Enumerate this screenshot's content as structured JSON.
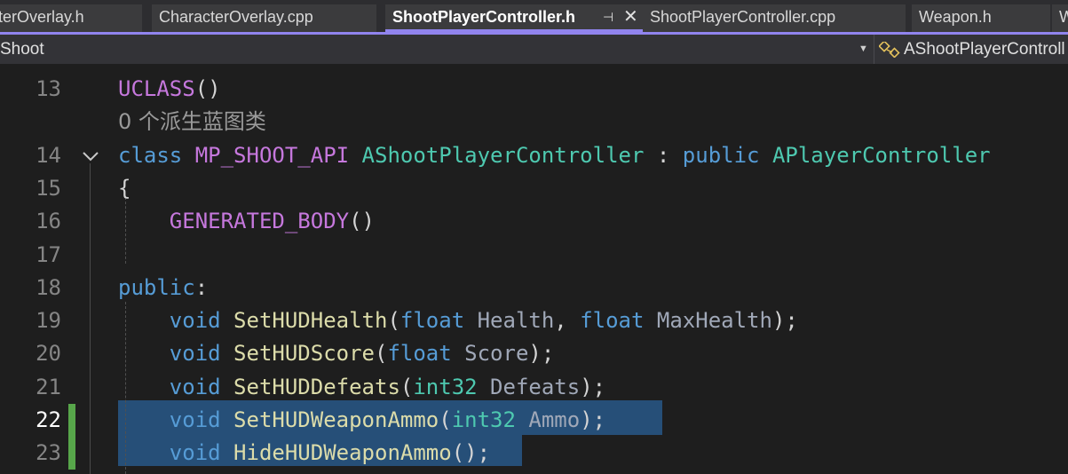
{
  "tabs": [
    {
      "label": "terOverlay.h",
      "active": false
    },
    {
      "label": "CharacterOverlay.cpp",
      "active": false
    },
    {
      "label": "ShootPlayerController.h",
      "active": true
    },
    {
      "label": "ShootPlayerController.cpp",
      "active": false
    },
    {
      "label": "Weapon.h",
      "active": false
    },
    {
      "label": "W",
      "active": false
    }
  ],
  "nav": {
    "project": "Shoot",
    "scope": "AShootPlayerControll"
  },
  "colors": {
    "accent": "#9184ee",
    "selection": "#264f78",
    "change_marker": "#57a64a"
  },
  "lines": [
    {
      "num": "13",
      "tokens": [
        {
          "t": "UCLASS",
          "c": "macro"
        },
        {
          "t": "()",
          "c": "p"
        }
      ]
    },
    {
      "num": "",
      "hint": "0 个派生蓝图类"
    },
    {
      "num": "14",
      "tokens": [
        {
          "t": "class ",
          "c": "kw"
        },
        {
          "t": "MP_SHOOT_API ",
          "c": "macro"
        },
        {
          "t": "AShootPlayerController",
          "c": "type"
        },
        {
          "t": " : ",
          "c": "p"
        },
        {
          "t": "public ",
          "c": "kw"
        },
        {
          "t": "APlayerController",
          "c": "type"
        }
      ]
    },
    {
      "num": "15",
      "tokens": [
        {
          "t": "{",
          "c": "p"
        }
      ]
    },
    {
      "num": "16",
      "tokens": [
        {
          "t": "    ",
          "c": "p"
        },
        {
          "t": "GENERATED_BODY",
          "c": "macro"
        },
        {
          "t": "()",
          "c": "p"
        }
      ]
    },
    {
      "num": "17",
      "tokens": []
    },
    {
      "num": "18",
      "tokens": [
        {
          "t": "public",
          "c": "kw"
        },
        {
          "t": ":",
          "c": "p"
        }
      ]
    },
    {
      "num": "19",
      "tokens": [
        {
          "t": "    ",
          "c": "p"
        },
        {
          "t": "void ",
          "c": "kw"
        },
        {
          "t": "SetHUDHealth",
          "c": "fn"
        },
        {
          "t": "(",
          "c": "p"
        },
        {
          "t": "float ",
          "c": "ptype"
        },
        {
          "t": "Health",
          "c": "pname2"
        },
        {
          "t": ", ",
          "c": "p"
        },
        {
          "t": "float ",
          "c": "ptype"
        },
        {
          "t": "MaxHealth",
          "c": "pname2"
        },
        {
          "t": ");",
          "c": "p"
        }
      ]
    },
    {
      "num": "20",
      "tokens": [
        {
          "t": "    ",
          "c": "p"
        },
        {
          "t": "void ",
          "c": "kw"
        },
        {
          "t": "SetHUDScore",
          "c": "fn"
        },
        {
          "t": "(",
          "c": "p"
        },
        {
          "t": "float ",
          "c": "ptype"
        },
        {
          "t": "Score",
          "c": "pname2"
        },
        {
          "t": ");",
          "c": "p"
        }
      ]
    },
    {
      "num": "21",
      "tokens": [
        {
          "t": "    ",
          "c": "p"
        },
        {
          "t": "void ",
          "c": "kw"
        },
        {
          "t": "SetHUDDefeats",
          "c": "fn"
        },
        {
          "t": "(",
          "c": "p"
        },
        {
          "t": "int32 ",
          "c": "type"
        },
        {
          "t": "Defeats",
          "c": "pname2"
        },
        {
          "t": ");",
          "c": "p"
        }
      ]
    },
    {
      "num": "22",
      "current": true,
      "tokens": [
        {
          "t": "    ",
          "c": "p"
        },
        {
          "t": "void ",
          "c": "kw"
        },
        {
          "t": "SetHUDWeaponAmmo",
          "c": "fn"
        },
        {
          "t": "(",
          "c": "p"
        },
        {
          "t": "int32 ",
          "c": "type"
        },
        {
          "t": "Ammo",
          "c": "pname2"
        },
        {
          "t": ");",
          "c": "p"
        }
      ]
    },
    {
      "num": "23",
      "tokens": [
        {
          "t": "    ",
          "c": "p"
        },
        {
          "t": "void ",
          "c": "kw"
        },
        {
          "t": "HideHUDWeaponAmmo",
          "c": "fn"
        },
        {
          "t": "();",
          "c": "p"
        }
      ]
    }
  ]
}
